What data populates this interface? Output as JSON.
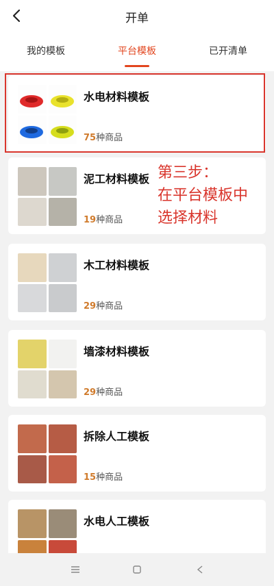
{
  "header": {
    "title": "开单",
    "back_icon": "chevron-left-icon"
  },
  "tabs": [
    {
      "label": "我的模板",
      "active": false
    },
    {
      "label": "平台模板",
      "active": true
    },
    {
      "label": "已开清单",
      "active": false
    }
  ],
  "templates": [
    {
      "name": "水电材料模板",
      "count": "75",
      "count_suffix": "种商品",
      "highlighted": true
    },
    {
      "name": "泥工材料模板",
      "count": "19",
      "count_suffix": "种商品"
    },
    {
      "name": "木工材料模板",
      "count": "29",
      "count_suffix": "种商品"
    },
    {
      "name": "墙漆材料模板",
      "count": "29",
      "count_suffix": "种商品"
    },
    {
      "name": "拆除人工模板",
      "count": "15",
      "count_suffix": "种商品"
    },
    {
      "name": "水电人工模板"
    }
  ],
  "annotation": {
    "lines": [
      "第三步：",
      "在平台模板中",
      "选择材料"
    ]
  },
  "navbar": {
    "icons": [
      "menu-icon",
      "home-square-icon",
      "back-triangle-icon"
    ]
  },
  "colors": {
    "accent": "#e2451e",
    "annotation": "#d9352c",
    "count": "#d07b2c"
  }
}
